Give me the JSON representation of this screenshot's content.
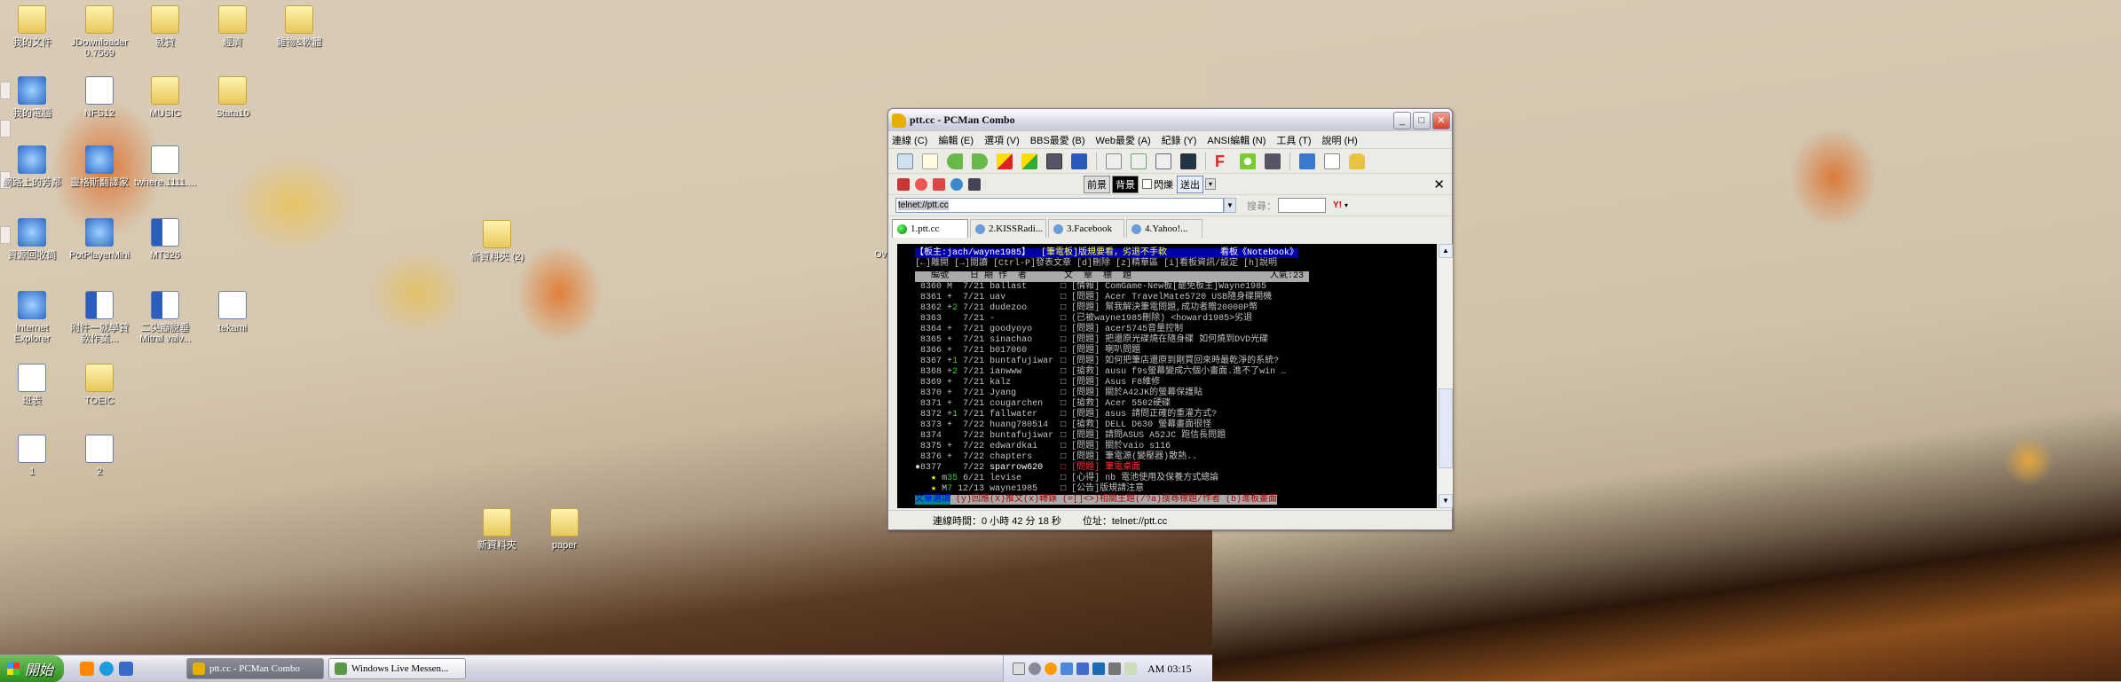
{
  "desktop_icons": [
    {
      "label": "我的文件",
      "kind": "folder"
    },
    {
      "label": "JDownloader 0.7569",
      "kind": "folder"
    },
    {
      "label": "就貸",
      "kind": "folder"
    },
    {
      "label": "經濟",
      "kind": "folder"
    },
    {
      "label": "雜物&軟體",
      "kind": "folder"
    },
    {
      "label": "我的電腦",
      "kind": "sys"
    },
    {
      "label": "NFS12",
      "kind": "doc"
    },
    {
      "label": "MUSIC",
      "kind": "folder"
    },
    {
      "label": "Stata10",
      "kind": "folder"
    },
    {
      "label": "網路上的芳鄰",
      "kind": "sys"
    },
    {
      "label": "靈格斯翻譯家",
      "kind": "sys"
    },
    {
      "label": "twhere.1111....",
      "kind": "doc"
    },
    {
      "label": "資源回收筒",
      "kind": "sys"
    },
    {
      "label": "PotPlayerMini",
      "kind": "sys"
    },
    {
      "label": "MT326",
      "kind": "word"
    },
    {
      "label": "Internet Explorer",
      "kind": "sys"
    },
    {
      "label": "附件一就學貸款作業...",
      "kind": "word"
    },
    {
      "label": "二尖瓣脫垂 Mitral valv...",
      "kind": "word"
    },
    {
      "label": "tekami",
      "kind": "doc"
    },
    {
      "label": "班表",
      "kind": "doc"
    },
    {
      "label": "TOEIC",
      "kind": "folder"
    },
    {
      "label": "1",
      "kind": "doc"
    },
    {
      "label": "2",
      "kind": "doc"
    },
    {
      "label": "新資料夾 (2)",
      "kind": "folder"
    },
    {
      "label": "新資料夾",
      "kind": "folder"
    },
    {
      "label": "paper",
      "kind": "folder"
    }
  ],
  "partial_label": "Ov",
  "window": {
    "title": "ptt.cc - PCMan Combo",
    "menu": [
      "連線 (C)",
      "編輯 (E)",
      "選項 (V)",
      "BBS最愛 (B)",
      "Web最愛 (A)",
      "紀錄 (Y)",
      "ANSI編輯 (N)",
      "工具 (T)",
      "說明 (H)"
    ],
    "ansi": {
      "fg": "前景",
      "bg": "背景",
      "blink": "閃爍",
      "send": "送出"
    },
    "address": "telnet://ptt.cc",
    "search_label": "搜尋：",
    "tabs": [
      "1.ptt.cc",
      "2.KISSRadi...",
      "3.Facebook",
      "4.Yahoo!..."
    ],
    "terminal": {
      "header_left": "【板主:jach/wayne1985】",
      "header_mid": "  [筆電板]版規要看，劣退不手軟",
      "header_right": "          看板《Notebook》",
      "help": "[←]離開 [→]閱讀 [Ctrl-P]發表文章 [d]刪除 [z]精華區 [i]看板資訊/設定 [h]說明",
      "colhead": "   編號    日 期 作  者       文  章  標  題                          人氣:23 ",
      "rows": [
        {
          "n": "8360",
          "m": "M",
          "p": " ",
          "d": "7/21",
          "a": "ballast",
          "t": "[情報] ComGame-New板[罷免板主]Wayne1985"
        },
        {
          "n": "8361",
          "m": "+",
          "p": " ",
          "d": "7/21",
          "a": "uav",
          "t": "[問題] Acer TravelMate5720 USB隨身碟開機"
        },
        {
          "n": "8362",
          "m": "+",
          "p": "2",
          "d": "7/21",
          "a": "dudezoo",
          "t": "[問題] 幫我解決筆電問題,成功者贈20000P幣"
        },
        {
          "n": "8363",
          "m": " ",
          "p": " ",
          "d": "7/21",
          "a": "-",
          "t": "(已被wayne1985刪除) <howard1985>劣退"
        },
        {
          "n": "8364",
          "m": "+",
          "p": " ",
          "d": "7/21",
          "a": "goodyoyo",
          "t": "[問題] acer5745音量控制"
        },
        {
          "n": "8365",
          "m": "+",
          "p": " ",
          "d": "7/21",
          "a": "sinachao",
          "t": "[問題] 把還原光碟燒在隨身碟 如何燒到DVD光碟"
        },
        {
          "n": "8366",
          "m": "+",
          "p": " ",
          "d": "7/21",
          "a": "b017060",
          "t": "[問題] 喇叭問題"
        },
        {
          "n": "8367",
          "m": "+",
          "p": "1",
          "d": "7/21",
          "a": "buntafujiwar",
          "t": "[問題] 如何把筆店還原到剛買回來時最乾淨的系統?"
        },
        {
          "n": "8368",
          "m": "+",
          "p": "2",
          "d": "7/21",
          "a": "ianwww",
          "t": "[搶救] ausu f9s螢幕變成六個小畫面.進不了win …"
        },
        {
          "n": "8369",
          "m": "+",
          "p": " ",
          "d": "7/21",
          "a": "kalz",
          "t": "[問題] Asus F8維修"
        },
        {
          "n": "8370",
          "m": "+",
          "p": " ",
          "d": "7/21",
          "a": "Jyang",
          "t": "[問題] 關於A42JK的螢幕保護貼"
        },
        {
          "n": "8371",
          "m": "+",
          "p": " ",
          "d": "7/21",
          "a": "cougarchen",
          "t": "[搶救] Acer 5502硬碟"
        },
        {
          "n": "8372",
          "m": "+",
          "p": "1",
          "d": "7/21",
          "a": "fallwater",
          "t": "[問題] asus 請問正確的重灌方式?"
        },
        {
          "n": "8373",
          "m": "+",
          "p": " ",
          "d": "7/22",
          "a": "huang780514",
          "t": "[搶救] DELL D630 螢幕畫面很怪"
        },
        {
          "n": "8374",
          "m": " ",
          "p": " ",
          "d": "7/22",
          "a": "buntafujiwar",
          "t": "[問題] 請問ASUS A52JC 跑信長問題"
        },
        {
          "n": "8375",
          "m": "+",
          "p": " ",
          "d": "7/22",
          "a": "edwardkai",
          "t": "[問題] 關於vaio s116"
        },
        {
          "n": "8376",
          "m": "+",
          "p": " ",
          "d": "7/22",
          "a": "chapters",
          "t": "[問題] 筆電源(變壓器)散熱.."
        },
        {
          "n": "8377",
          "m": " ",
          "p": " ",
          "d": "7/22",
          "a": "sparrow620",
          "t": "[問題] 筆電桌面",
          "sel": true
        },
        {
          "n": "  ★",
          "m": "m",
          "p": "35",
          "d": "6/21",
          "a": "levise",
          "t": "[心得] nb 電池使用及保養方式總論"
        },
        {
          "n": "  ★",
          "m": "M",
          "p": "7",
          "d": "12/13",
          "a": "wayne1985",
          "t": "[公告]版規請注意"
        }
      ],
      "footer_mode": "文章選讀",
      "footer_keys": " (y)回應(X)推文(x)轉錄 (=[]<>)相關主題(/?a)搜尋標題/作者 (b)進板畫面"
    },
    "status": {
      "time_label": "連線時間：0 小時 42 分 18 秒",
      "addr_label": "位址：telnet://ptt.cc"
    }
  },
  "taskbar": {
    "start": "開始",
    "tasks": [
      {
        "label": "ptt.cc - PCMan Combo",
        "active": true
      },
      {
        "label": "Windows Live Messen...",
        "active": false
      }
    ],
    "clock": "AM 03:15"
  },
  "colors": {
    "term_bg": "#000000",
    "header_bg": "#0000aa",
    "header_yellow": "#ffff55",
    "selected_red": "#ff3333",
    "push_green": "#33cc33",
    "footer_teal": "#008888",
    "footer_gray": "#aaaaaa"
  }
}
